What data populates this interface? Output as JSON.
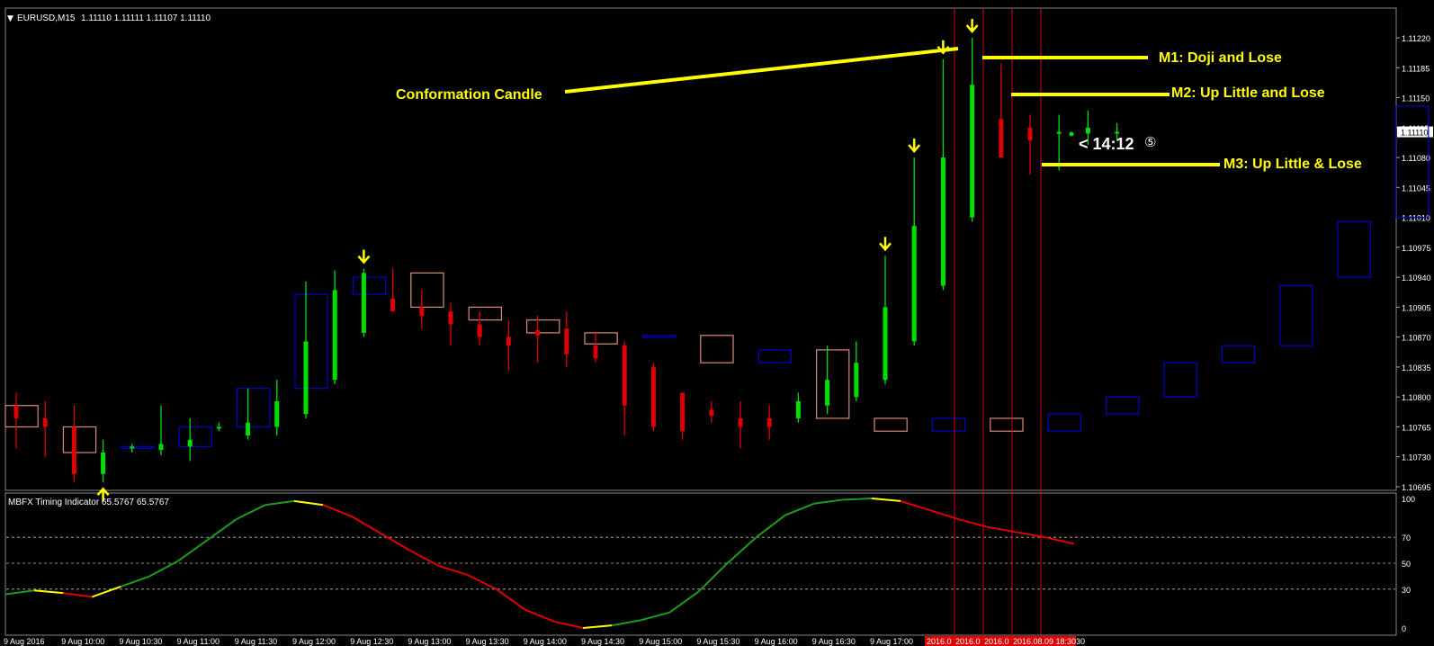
{
  "header": {
    "symbol_label": "EURUSD,M15",
    "ohlc": "1.11110 1.11111 1.11107 1.11110"
  },
  "indicator": {
    "label": "MBFX Timing Indicator 65.5767 65.5767",
    "levels": [
      0,
      30,
      50,
      70,
      100
    ]
  },
  "annotations": {
    "confirmation": "Conformation Candle",
    "m1": "M1: Doji and Lose",
    "m2": "M2: Up Little and Lose",
    "m3": "M3: Up Little & Lose",
    "timer": "< 14:12",
    "timer_icon": "circled-5"
  },
  "colors": {
    "background": "#000000",
    "bull_body": "#00e000",
    "bear_body": "#e00000",
    "htf_bull_box": "#0000cc",
    "htf_bear_box": "#d98b7b",
    "annotation": "#ffff00",
    "ind_up": "#1b9e1b",
    "ind_down": "#e00000",
    "ind_turn": "#ffff00",
    "vline": "#e00000"
  },
  "chart_data": [
    {
      "type": "candlestick",
      "title": "EURUSD,M15",
      "y_ticks": [
        "1.11220",
        "1.11185",
        "1.11150",
        "1.11115",
        "1.11080",
        "1.11045",
        "1.11010",
        "1.10975",
        "1.10940",
        "1.10905",
        "1.10870",
        "1.10835",
        "1.10800",
        "1.10765",
        "1.10730",
        "1.10695"
      ],
      "current_price": "1.11110",
      "ylim": [
        1.10695,
        1.1122
      ],
      "x_ticks": [
        "9 Aug 2016",
        "9 Aug 10:00",
        "9 Aug 10:30",
        "9 Aug 11:00",
        "9 Aug 11:30",
        "9 Aug 12:00",
        "9 Aug 12:30",
        "9 Aug 13:00",
        "9 Aug 13:30",
        "9 Aug 14:00",
        "9 Aug 14:30",
        "9 Aug 15:00",
        "9 Aug 15:30",
        "9 Aug 16:00",
        "9 Aug 16:30",
        "9 Aug 17:00"
      ],
      "x_ticks_highlight": [
        "2016.0",
        "2016.0",
        "2016.0",
        "2016.08.09 18:30",
        "30"
      ],
      "candles": [
        {
          "o": 1.1079,
          "h": 1.10805,
          "l": 1.1074,
          "c": 1.10775
        },
        {
          "o": 1.10775,
          "h": 1.10795,
          "l": 1.1073,
          "c": 1.10765
        },
        {
          "o": 1.10765,
          "h": 1.1079,
          "l": 1.107,
          "c": 1.1071
        },
        {
          "o": 1.1071,
          "h": 1.1075,
          "l": 1.107,
          "c": 1.10735
        },
        {
          "o": 1.1074,
          "h": 1.10745,
          "l": 1.10735,
          "c": 1.10742
        },
        {
          "o": 1.10738,
          "h": 1.1079,
          "l": 1.10732,
          "c": 1.10745
        },
        {
          "o": 1.10742,
          "h": 1.10775,
          "l": 1.10725,
          "c": 1.1075
        },
        {
          "o": 1.10765,
          "h": 1.1077,
          "l": 1.1076,
          "c": 1.10765
        },
        {
          "o": 1.10755,
          "h": 1.1081,
          "l": 1.1075,
          "c": 1.1077
        },
        {
          "o": 1.10765,
          "h": 1.1082,
          "l": 1.10755,
          "c": 1.10795
        },
        {
          "o": 1.1078,
          "h": 1.10935,
          "l": 1.10775,
          "c": 1.10865
        },
        {
          "o": 1.1082,
          "h": 1.10948,
          "l": 1.10815,
          "c": 1.10925
        },
        {
          "o": 1.10875,
          "h": 1.1095,
          "l": 1.1087,
          "c": 1.10945
        },
        {
          "o": 1.10915,
          "h": 1.1095,
          "l": 1.109,
          "c": 1.109
        },
        {
          "o": 1.10905,
          "h": 1.10925,
          "l": 1.1088,
          "c": 1.10895
        },
        {
          "o": 1.109,
          "h": 1.1091,
          "l": 1.1086,
          "c": 1.10885
        },
        {
          "o": 1.10885,
          "h": 1.109,
          "l": 1.1086,
          "c": 1.1087
        },
        {
          "o": 1.1087,
          "h": 1.1089,
          "l": 1.1083,
          "c": 1.1086
        },
        {
          "o": 1.10878,
          "h": 1.10895,
          "l": 1.1084,
          "c": 1.10872
        },
        {
          "o": 1.1088,
          "h": 1.109,
          "l": 1.10835,
          "c": 1.1085
        },
        {
          "o": 1.1086,
          "h": 1.10875,
          "l": 1.1084,
          "c": 1.10845
        },
        {
          "o": 1.1086,
          "h": 1.10865,
          "l": 1.10755,
          "c": 1.1079
        },
        {
          "o": 1.10835,
          "h": 1.1084,
          "l": 1.1076,
          "c": 1.10765
        },
        {
          "o": 1.10805,
          "h": 1.10805,
          "l": 1.1075,
          "c": 1.1076
        },
        {
          "o": 1.10785,
          "h": 1.10795,
          "l": 1.1077,
          "c": 1.10778
        },
        {
          "o": 1.10775,
          "h": 1.10795,
          "l": 1.1074,
          "c": 1.10765
        },
        {
          "o": 1.10775,
          "h": 1.1079,
          "l": 1.1075,
          "c": 1.10765
        },
        {
          "o": 1.10775,
          "h": 1.10805,
          "l": 1.1077,
          "c": 1.10795
        },
        {
          "o": 1.1079,
          "h": 1.1086,
          "l": 1.1078,
          "c": 1.1082
        },
        {
          "o": 1.108,
          "h": 1.10865,
          "l": 1.10795,
          "c": 1.1084
        },
        {
          "o": 1.1082,
          "h": 1.10965,
          "l": 1.10815,
          "c": 1.10905
        },
        {
          "o": 1.10865,
          "h": 1.1108,
          "l": 1.1086,
          "c": 1.11
        },
        {
          "o": 1.1093,
          "h": 1.11195,
          "l": 1.10925,
          "c": 1.1108
        },
        {
          "o": 1.1101,
          "h": 1.1122,
          "l": 1.11005,
          "c": 1.11165
        },
        {
          "o": 1.11125,
          "h": 1.1119,
          "l": 1.111,
          "c": 1.1108
        },
        {
          "o": 1.11115,
          "h": 1.1113,
          "l": 1.1106,
          "c": 1.111
        },
        {
          "o": 1.1111,
          "h": 1.1113,
          "l": 1.11065,
          "c": 1.1111
        },
        {
          "o": 1.11108,
          "h": 1.11135,
          "l": 1.11095,
          "c": 1.11115
        },
        {
          "o": 1.11108,
          "h": 1.1112,
          "l": 1.111,
          "c": 1.1111
        }
      ],
      "htf_boxes": [
        {
          "o": 1.1079,
          "c": 1.10765
        },
        {
          "o": 1.10765,
          "c": 1.10735
        },
        {
          "o": 1.1074,
          "c": 1.10742
        },
        {
          "o": 1.10742,
          "c": 1.10765
        },
        {
          "o": 1.10765,
          "c": 1.1081
        },
        {
          "o": 1.1081,
          "c": 1.1092
        },
        {
          "o": 1.1092,
          "c": 1.1094
        },
        {
          "o": 1.10945,
          "c": 1.10905
        },
        {
          "o": 1.10905,
          "c": 1.1089
        },
        {
          "o": 1.1089,
          "c": 1.10875
        },
        {
          "o": 1.10875,
          "c": 1.10862
        },
        {
          "o": 1.1087,
          "c": 1.10872
        },
        {
          "o": 1.10872,
          "c": 1.1084
        },
        {
          "o": 1.1084,
          "c": 1.10855
        },
        {
          "o": 1.10855,
          "c": 1.10775
        },
        {
          "o": 1.10775,
          "c": 1.1076
        },
        {
          "o": 1.1076,
          "c": 1.10775
        },
        {
          "o": 1.10775,
          "c": 1.1076
        },
        {
          "o": 1.1076,
          "c": 1.1078
        },
        {
          "o": 1.1078,
          "c": 1.108
        },
        {
          "o": 1.108,
          "c": 1.1084
        },
        {
          "o": 1.1084,
          "c": 1.1086
        },
        {
          "o": 1.1086,
          "c": 1.1093
        },
        {
          "o": 1.1094,
          "c": 1.11005
        },
        {
          "o": 1.1101,
          "c": 1.1114
        },
        {
          "o": 1.1114,
          "c": 1.11175
        },
        {
          "o": 1.11175,
          "c": 1.1108
        },
        {
          "o": 1.1108,
          "c": 1.111
        },
        {
          "o": 1.1111,
          "c": 1.11108
        },
        {
          "o": 1.111,
          "c": 1.1111
        },
        {
          "o": 1.1111,
          "c": 1.11115
        }
      ],
      "arrows": [
        {
          "candle": 3,
          "dir": "up"
        },
        {
          "candle": 12,
          "dir": "down"
        },
        {
          "candle": 30,
          "dir": "down"
        },
        {
          "candle": 31,
          "dir": "down"
        },
        {
          "candle": 32,
          "dir": "down"
        },
        {
          "candle": 33,
          "dir": "down"
        }
      ]
    },
    {
      "type": "line",
      "title": "MBFX Timing Indicator",
      "ylim": [
        0,
        100
      ],
      "y_ticks": [
        "100",
        "70",
        "50",
        "30",
        "0"
      ],
      "values": [
        26,
        29,
        27,
        24,
        32,
        40,
        52,
        68,
        84,
        95,
        98,
        95,
        86,
        73,
        60,
        48,
        41,
        30,
        14,
        5,
        0,
        2,
        6,
        12,
        28,
        50,
        70,
        87,
        96,
        99,
        100,
        98,
        91,
        84,
        78,
        74,
        70,
        65
      ]
    }
  ]
}
